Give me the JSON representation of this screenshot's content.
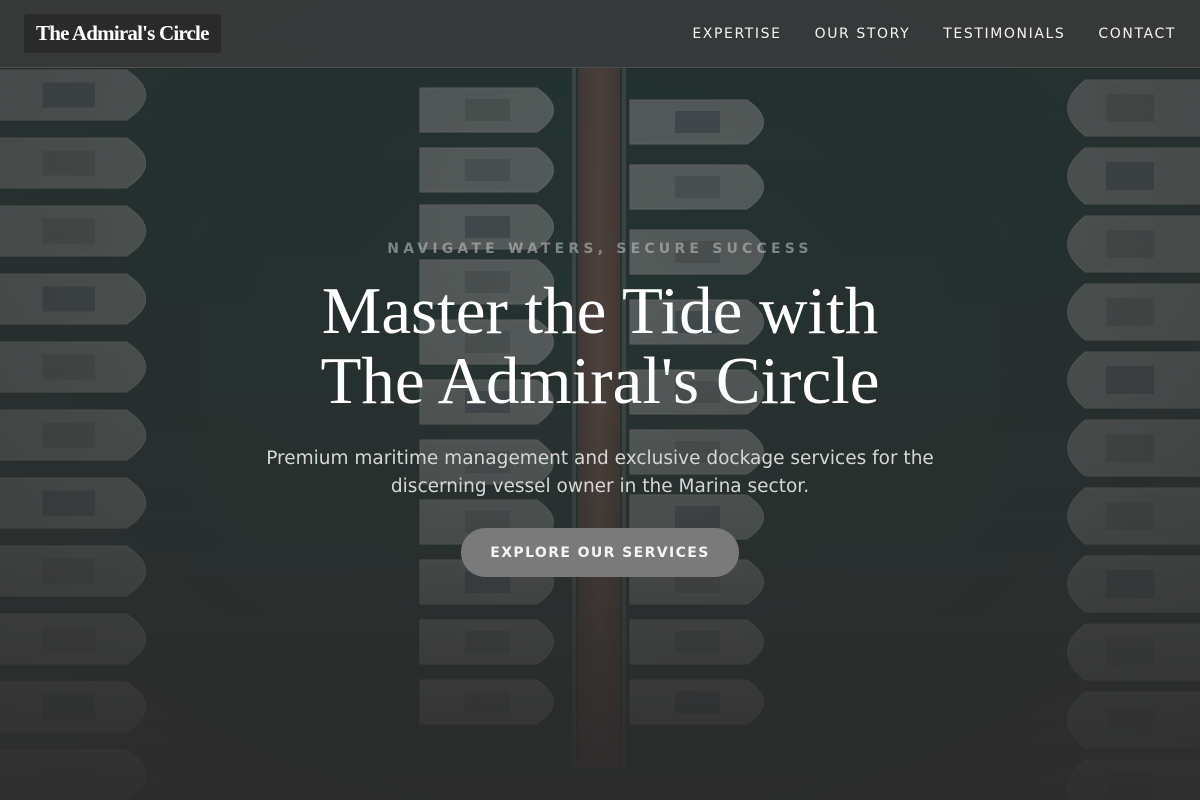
{
  "header": {
    "logo_text": "The Admiral's Circle",
    "nav": [
      {
        "label": "EXPERTISE"
      },
      {
        "label": "OUR STORY"
      },
      {
        "label": "TESTIMONIALS"
      },
      {
        "label": "CONTACT"
      }
    ]
  },
  "hero": {
    "eyebrow": "NAVIGATE WATERS, SECURE SUCCESS",
    "title_line1": "Master the Tide with",
    "title_line2": "The Admiral's Circle",
    "subtitle_line1": "Premium maritime management and exclusive dockage services for the",
    "subtitle_line2": "discerning vessel owner in the Marina sector.",
    "cta_label": "EXPLORE OUR SERVICES",
    "background_image": "aerial-marina-photo"
  },
  "colors": {
    "header_bg": "#3c3c3c",
    "logo_bg": "#2a2a2a",
    "cta_bg": "#7a7a7a",
    "page_bg": "#2b2b2b"
  }
}
